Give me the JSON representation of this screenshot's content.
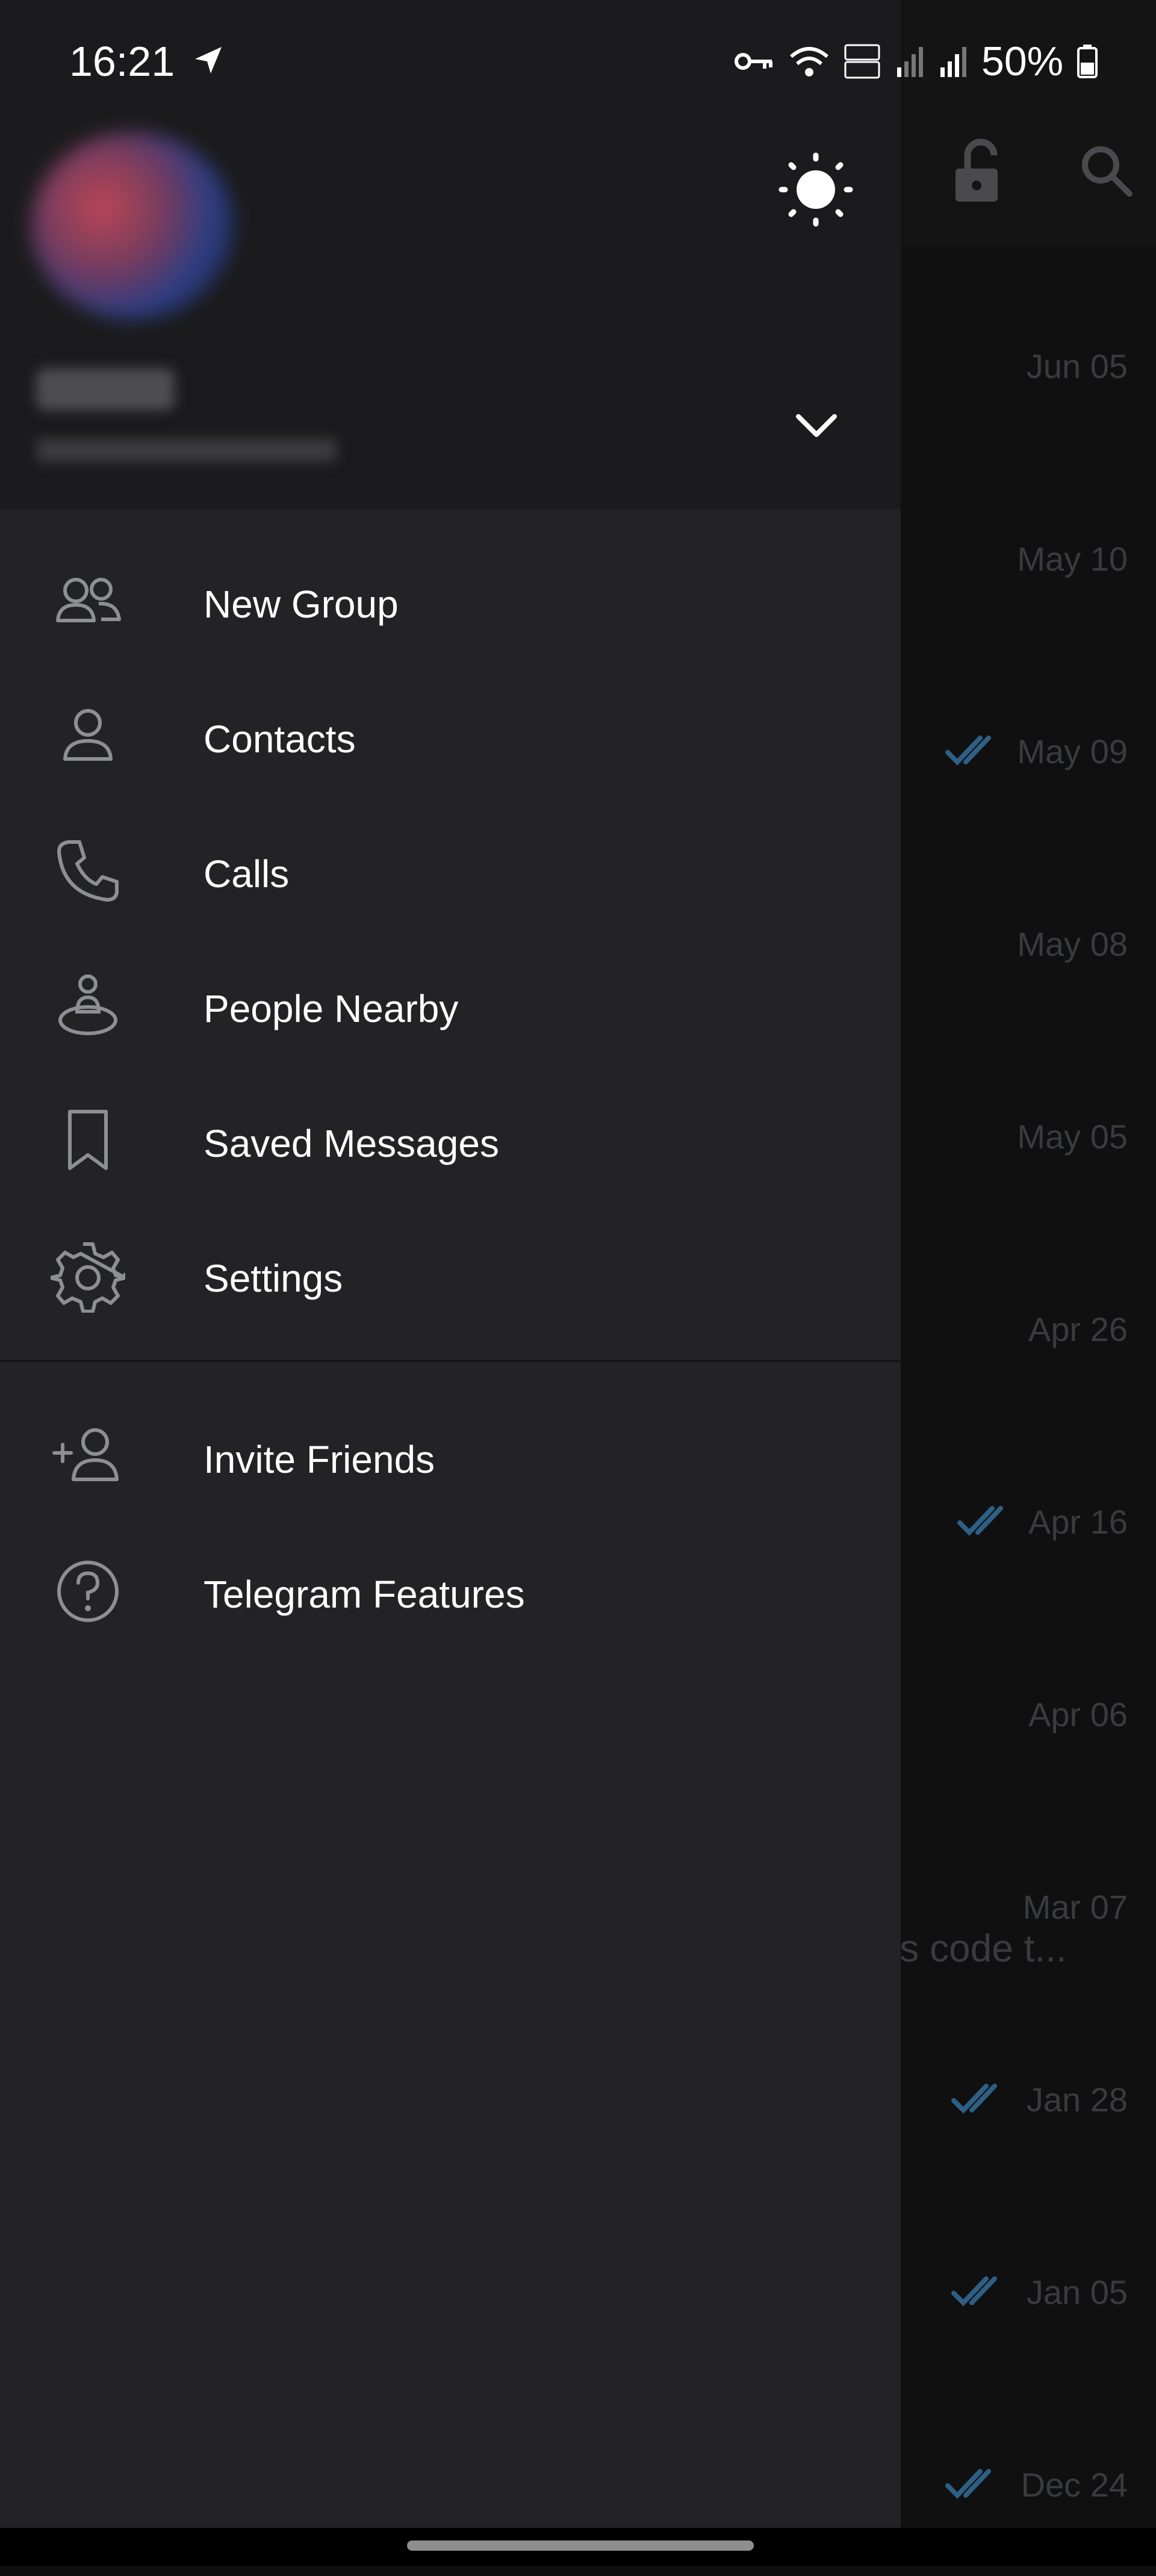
{
  "status_bar": {
    "time": "16:21",
    "battery": "50%"
  },
  "drawer": {
    "menu_primary": [
      {
        "label": "New Group",
        "icon": "people-icon"
      },
      {
        "label": "Contacts",
        "icon": "person-icon"
      },
      {
        "label": "Calls",
        "icon": "phone-icon"
      },
      {
        "label": "People Nearby",
        "icon": "people-nearby-icon"
      },
      {
        "label": "Saved Messages",
        "icon": "bookmark-icon"
      },
      {
        "label": "Settings",
        "icon": "gear-icon"
      }
    ],
    "menu_secondary": [
      {
        "label": "Invite Friends",
        "icon": "add-person-icon"
      },
      {
        "label": "Telegram Features",
        "icon": "help-icon"
      }
    ]
  },
  "background_chats": {
    "dates": [
      "Jun 05",
      "May 10",
      "May 09",
      "May 08",
      "May 05",
      "Apr 26",
      "Apr 16",
      "Apr 06",
      "Mar 07",
      "Jan 28",
      "Jan 05",
      "Dec 24"
    ],
    "preview_snippet": "is code t..."
  },
  "colors": {
    "drawer_bg": "#232326",
    "header_bg": "#1b1b1d",
    "check_blue": "#2e5f84"
  }
}
